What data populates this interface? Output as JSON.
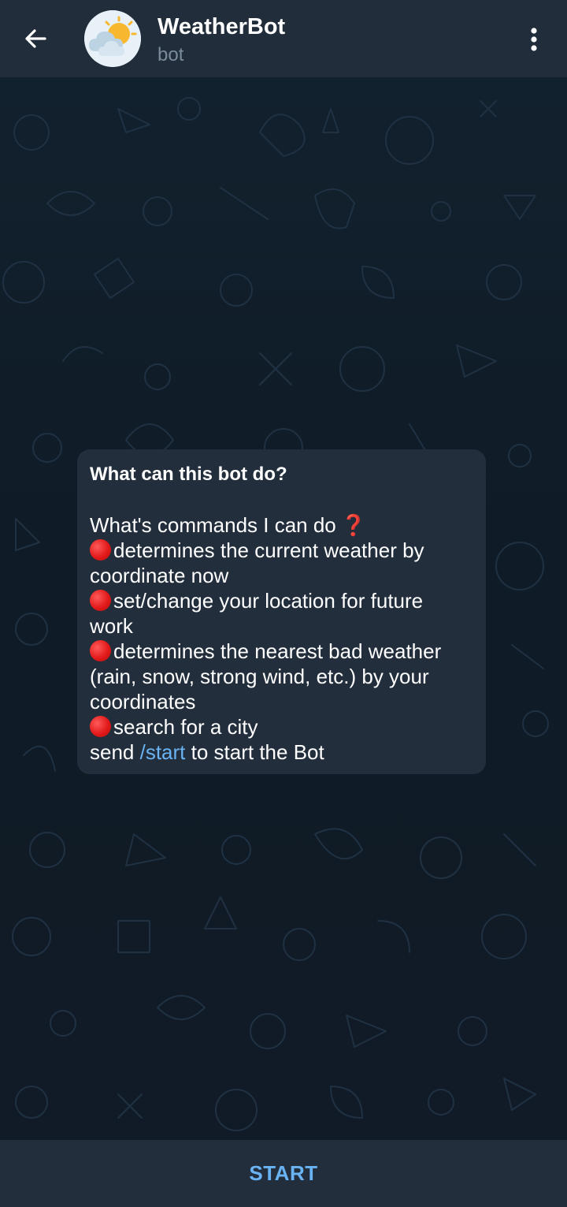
{
  "header": {
    "title": "WeatherBot",
    "subtitle": "bot",
    "back_icon": "arrow-left-icon",
    "avatar_icon": "sun-cloud-icon",
    "menu_icon": "more-vertical-icon"
  },
  "message": {
    "title": "What can this bot do?",
    "intro": "What's commands I can do",
    "intro_emoji": "❓",
    "bullet_icon": "red-circle-icon",
    "lines": {
      "l1": "determines the current weather by",
      "l2": "coordinate now",
      "l3": "set/change your location for future",
      "l4": "work",
      "l5": "determines the nearest bad weather",
      "l6": "(rain, snow, strong wind, etc.) by your",
      "l7": "coordinates",
      "l8": "search for a city"
    },
    "footer_prefix": "send ",
    "footer_command": "/start",
    "footer_suffix": " to start the Bot"
  },
  "bottom_bar": {
    "start_label": "START"
  },
  "colors": {
    "header_bg": "#212d3b",
    "bubble_bg": "#222e3c",
    "accent": "#6ab3f3",
    "bullet_red": "#e21a1a"
  }
}
